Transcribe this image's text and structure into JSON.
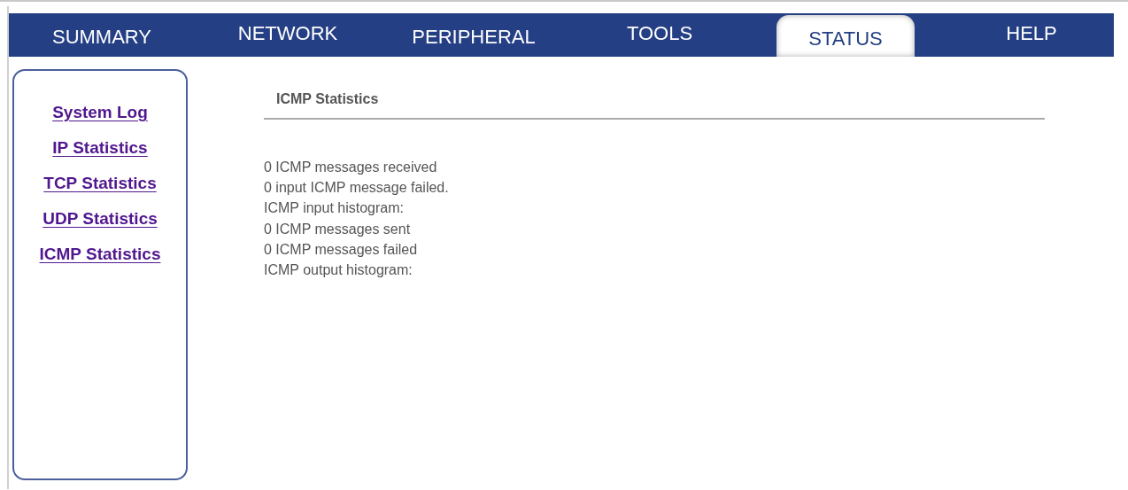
{
  "tabs": [
    {
      "label": "SUMMARY",
      "selected": false
    },
    {
      "label": "NETWORK",
      "selected": false
    },
    {
      "label": "PERIPHERAL",
      "selected": false
    },
    {
      "label": "TOOLS",
      "selected": false
    },
    {
      "label": "STATUS",
      "selected": true
    },
    {
      "label": "HELP",
      "selected": false
    }
  ],
  "sidebar": {
    "items": [
      "System Log",
      "IP Statistics",
      "TCP Statistics",
      "UDP Statistics",
      "ICMP Statistics"
    ]
  },
  "content": {
    "title": "ICMP Statistics",
    "lines": [
      "0 ICMP messages received",
      "0 input ICMP message failed.",
      "ICMP input histogram:",
      "0 ICMP messages sent",
      "0 ICMP messages failed",
      "ICMP output histogram:"
    ]
  }
}
